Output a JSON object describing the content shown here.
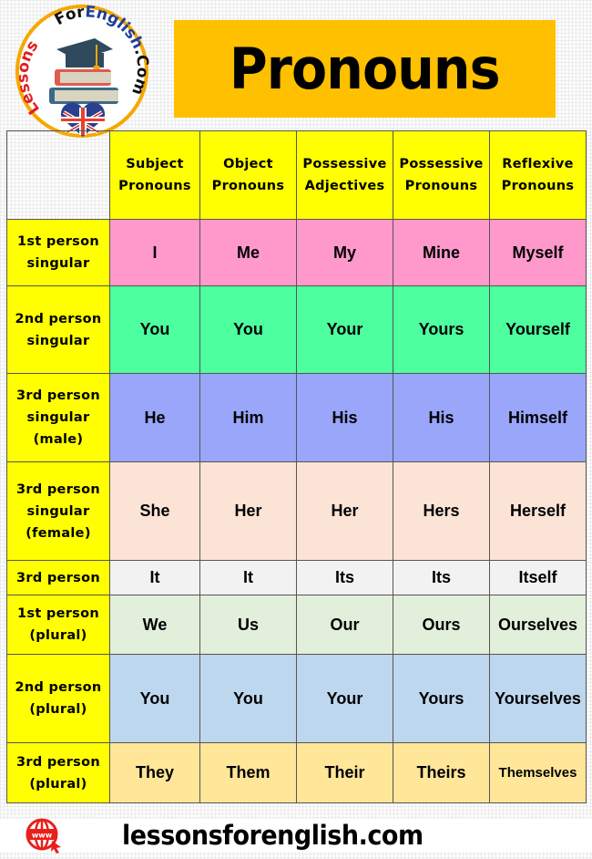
{
  "logo": {
    "text_lessons": "Lessons",
    "text_for": "For",
    "text_english": "English",
    "text_com": ".Com"
  },
  "title": "Pronouns",
  "colors": {
    "title_bg": "#ffc000",
    "header_bg": "#ffff00"
  },
  "table": {
    "columns": [
      {
        "line1": "Subject",
        "line2": "Pronouns"
      },
      {
        "line1": "Object",
        "line2": "Pronouns"
      },
      {
        "line1": "Possessive",
        "line2": "Adjectives"
      },
      {
        "line1": "Possessive",
        "line2": "Pronouns"
      },
      {
        "line1": "Reflexive",
        "line2": "Pronouns"
      }
    ],
    "rows": [
      {
        "label": [
          "1st person",
          "singular"
        ],
        "color": "#ff99cc",
        "cells": [
          "I",
          "Me",
          "My",
          "Mine",
          "Myself"
        ]
      },
      {
        "label": [
          "2nd person",
          "singular"
        ],
        "color": "#4dff9e",
        "cells": [
          "You",
          "You",
          "Your",
          "Yours",
          "Yourself"
        ]
      },
      {
        "label": [
          "3rd person",
          "singular",
          "(male)"
        ],
        "color": "#99a6fa",
        "cells": [
          "He",
          "Him",
          "His",
          "His",
          "Himself"
        ]
      },
      {
        "label": [
          "3rd person",
          "singular",
          "(female)"
        ],
        "color": "#fbe4d6",
        "cells": [
          "She",
          "Her",
          "Her",
          "Hers",
          "Herself"
        ]
      },
      {
        "label": [
          "3rd person"
        ],
        "color": "#f2f2f2",
        "cells": [
          "It",
          "It",
          "Its",
          "Its",
          "Itself"
        ]
      },
      {
        "label": [
          "1st person",
          "(plural)"
        ],
        "color": "#e2efda",
        "cells": [
          "We",
          "Us",
          "Our",
          "Ours",
          "Ourselves"
        ]
      },
      {
        "label": [
          "2nd person",
          "(plural)"
        ],
        "color": "#bdd7ee",
        "cells": [
          "You",
          "You",
          "Your",
          "Yours",
          "Yourselves"
        ]
      },
      {
        "label": [
          "3rd person",
          "(plural)"
        ],
        "color": "#ffe699",
        "cells": [
          "They",
          "Them",
          "Their",
          "Theirs",
          "Themselves"
        ]
      }
    ]
  },
  "footer": {
    "icon_text": "www",
    "url": "lessonsforenglish.com"
  }
}
